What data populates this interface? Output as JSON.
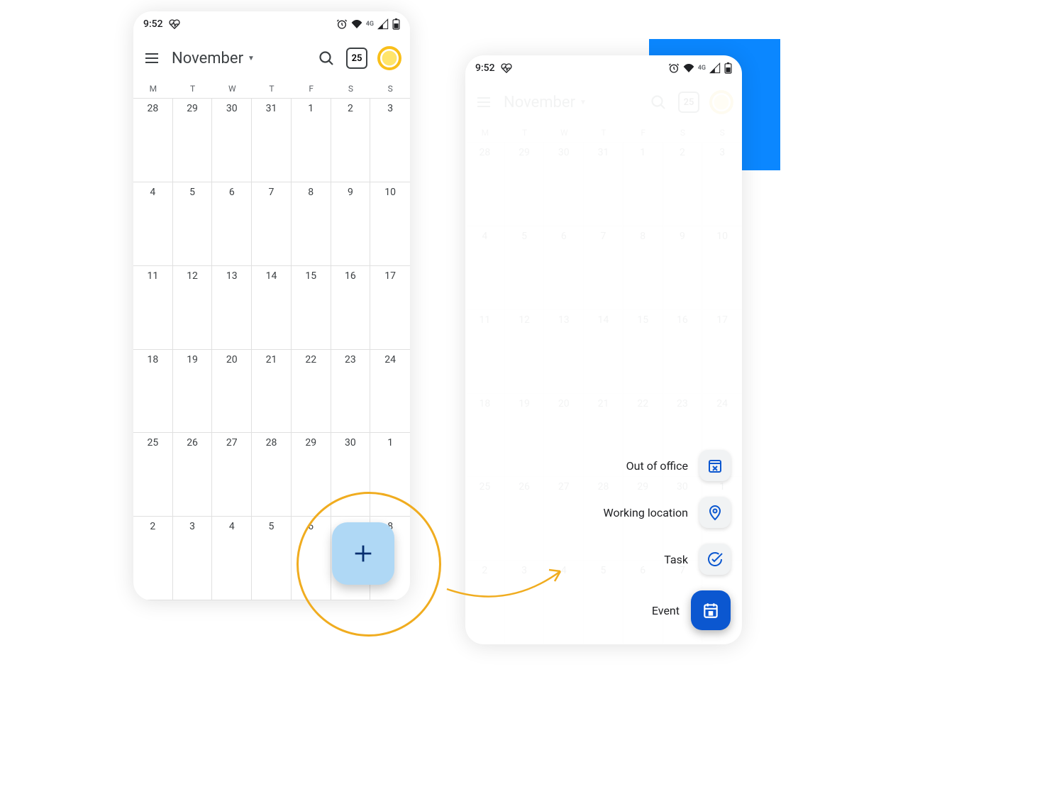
{
  "status": {
    "time": "9:52",
    "net_label": "4G"
  },
  "appbar": {
    "month": "November",
    "today_number": "25"
  },
  "weekdays": [
    "M",
    "T",
    "W",
    "T",
    "F",
    "S",
    "S"
  ],
  "days": [
    "28",
    "29",
    "30",
    "31",
    "1",
    "2",
    "3",
    "4",
    "5",
    "6",
    "7",
    "8",
    "9",
    "10",
    "11",
    "12",
    "13",
    "14",
    "15",
    "16",
    "17",
    "18",
    "19",
    "20",
    "21",
    "22",
    "23",
    "24",
    "25",
    "26",
    "27",
    "28",
    "29",
    "30",
    "1",
    "2",
    "3",
    "4",
    "5",
    "6",
    "7",
    "8"
  ],
  "fab_menu": {
    "out_of_office": "Out of office",
    "working_location": "Working location",
    "task": "Task",
    "event": "Event"
  }
}
